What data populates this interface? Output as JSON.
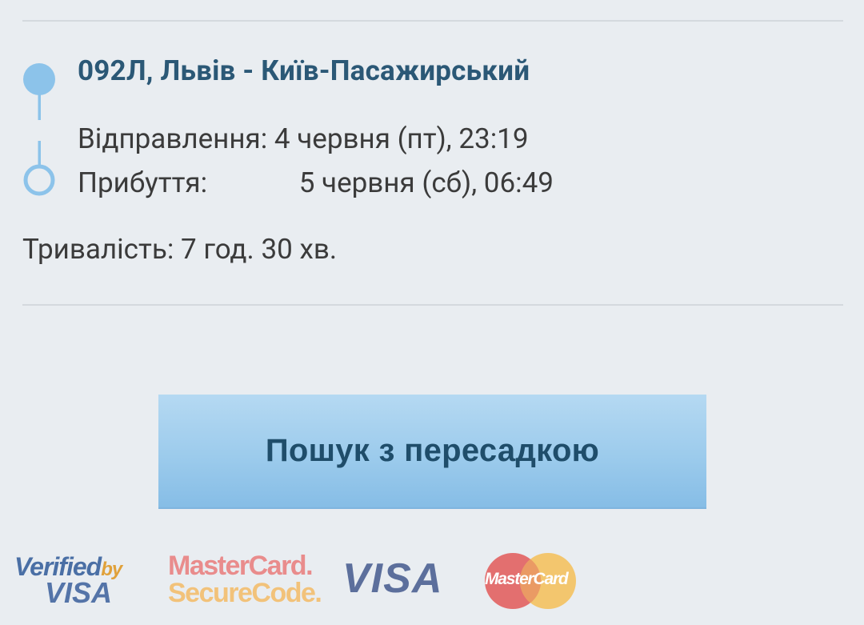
{
  "train": {
    "title": "092Л, Львів - Київ-Пасажирський"
  },
  "departure": {
    "label": "Відправлення:",
    "value": "4 червня (пт), 23:19"
  },
  "arrival": {
    "label": "Прибуття:",
    "value": "5 червня (сб), 06:49"
  },
  "duration": {
    "text": "Тривалість: 7 год. 30 хв."
  },
  "actions": {
    "transfer_search_label": "Пошук з пересадкою"
  },
  "payment_logos": {
    "verified_by": "Verified",
    "verified_by_suffix": "by",
    "verified_visa": "VISA",
    "mastercard_securecode_line1": "MasterCard.",
    "mastercard_securecode_line2": "SecureCode.",
    "visa": "VISA",
    "mastercard": "MasterCard"
  },
  "colors": {
    "accent": "#2b5876",
    "route_icon": "#8cc3ea",
    "button_gradient_top": "#b5d9f2",
    "button_gradient_bottom": "#86bde6",
    "background": "#e9edf1"
  }
}
